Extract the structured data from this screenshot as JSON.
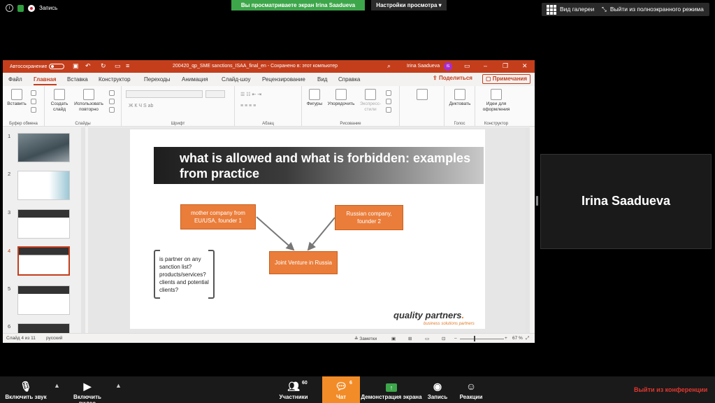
{
  "zoom_top": {
    "record_label": "Запись",
    "sharing_banner": "Вы просматриваете экран Irina Saadueva",
    "view_settings": "Настройки просмотра",
    "gallery_view": "Вид галереи",
    "exit_fullscreen": "Выйти из полноэкранного режима"
  },
  "ppt": {
    "autosave_label": "Автосохранение",
    "doc_title": "200420_qp_SME sanctions_ISAA_final_en  -  Сохранено в: этот компьютер",
    "user_name": "Irina Saadueva",
    "user_initials": "IS",
    "tabs": [
      "Файл",
      "Главная",
      "Вставка",
      "Конструктор",
      "Переходы",
      "Анимация",
      "Слайд-шоу",
      "Рецензирование",
      "Вид",
      "Справка"
    ],
    "share_label": "Поделиться",
    "comments_label": "Примечания",
    "ribbon": {
      "paste": "Вставить",
      "clipboard_group": "Буфер обмена",
      "new_slide": "Создать слайд",
      "reuse_slides": "Использовать повторно",
      "slides_group": "Слайды",
      "font_group": "Шрифт",
      "paragraph_group": "Абзац",
      "shapes": "Фигуры",
      "arrange": "Упорядочить",
      "quick_styles": "Экспресс-стили",
      "drawing_group": "Рисование",
      "dictate": "Диктовать",
      "voice_group": "Голос",
      "design_ideas": "Идеи для оформления",
      "designer_group": "Конструктор",
      "format_letters": "Ж К Ч S ab"
    },
    "thumb_numbers": [
      "1",
      "2",
      "3",
      "4",
      "5",
      "6"
    ],
    "slide": {
      "title": "what is allowed and what is forbidden: examples from practice",
      "box_mother": "mother company from EU/USA, founder 1",
      "box_russian": "Russian company, founder 2",
      "box_jv": "Joint Venture in Russia",
      "bracket_text": "is partner on any sanction list? products/services? clients and potential clients?",
      "logo_main": "quality partners",
      "logo_sub": "business solutions partners"
    },
    "status": {
      "slide_counter": "Слайд 4 из 11",
      "language": "русский",
      "notes": "Заметки",
      "zoom": "67 %"
    }
  },
  "participant": {
    "name": "Irina Saadueva"
  },
  "bottom_bar": {
    "unmute": "Включить звук",
    "start_video": "Включить видео",
    "participants": "Участники",
    "participants_count": "60",
    "chat": "Чат",
    "chat_count": "6",
    "share_screen": "Демонстрация экрана",
    "record": "Запись",
    "reactions": "Реакции",
    "leave": "Выйти из конференции"
  }
}
